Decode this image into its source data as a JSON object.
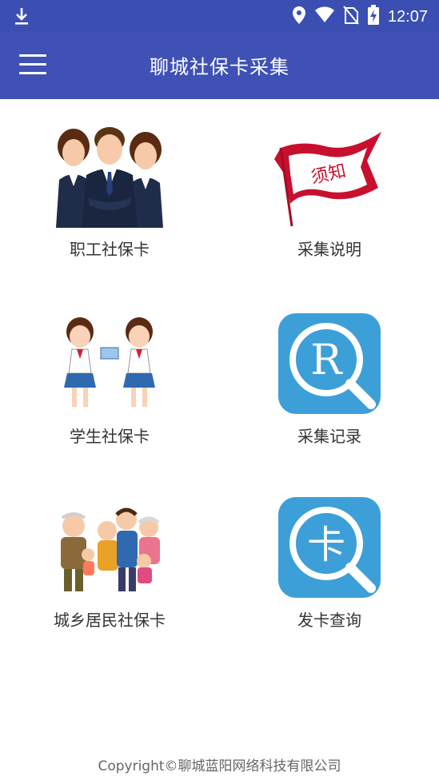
{
  "status_bar": {
    "time": "12:07",
    "icons": [
      "download-icon",
      "location-icon",
      "wifi-icon",
      "no-sim-icon",
      "battery-charging-icon"
    ]
  },
  "app_bar": {
    "title": "聊城社保卡采集",
    "menu_icon": "hamburger-menu-icon"
  },
  "tiles": [
    {
      "label": "职工社保卡",
      "icon": "employees-illustration"
    },
    {
      "label": "采集说明",
      "icon": "notice-flag-icon",
      "flag_text": "须知"
    },
    {
      "label": "学生社保卡",
      "icon": "students-illustration"
    },
    {
      "label": "采集记录",
      "icon": "registered-search-icon",
      "glyph": "R"
    },
    {
      "label": "城乡居民社保卡",
      "icon": "family-illustration"
    },
    {
      "label": "发卡查询",
      "icon": "card-search-icon",
      "glyph": "卡"
    }
  ],
  "footer": {
    "copyright": "Copyright©聊城蓝阳网络科技有限公司"
  },
  "colors": {
    "status_bar": "#3a4fb1",
    "app_bar": "#3f51b5",
    "flag_red": "#c8102e",
    "icon_blue": "#3d9fd8"
  }
}
